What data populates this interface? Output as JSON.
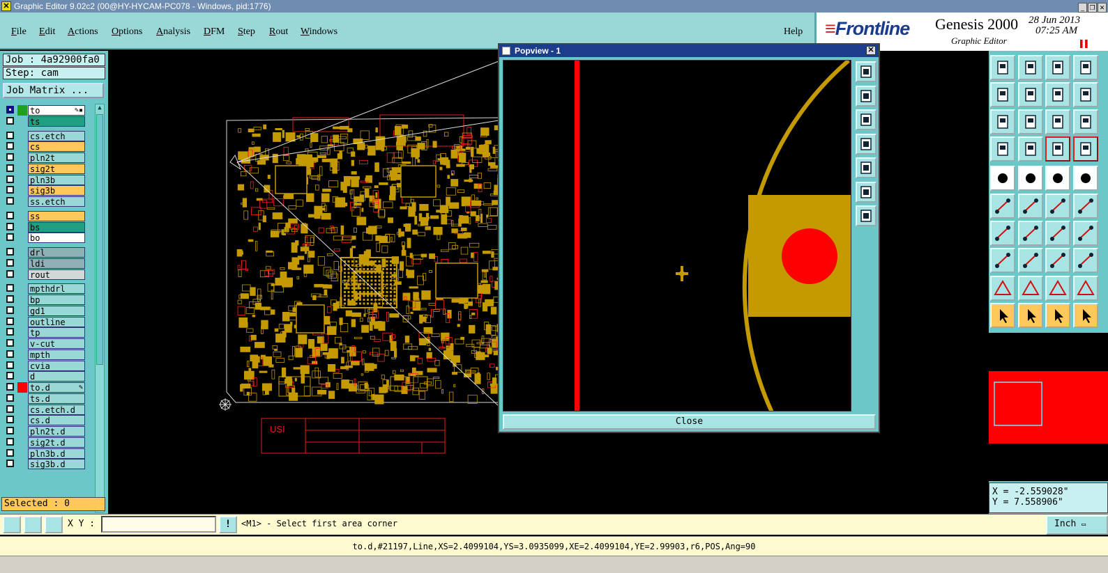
{
  "window": {
    "title": "Graphic Editor 9.02c2 (00@HY-HYCAM-PC078 - Windows, pid:1776)"
  },
  "menu": {
    "items": [
      {
        "label": "File",
        "u": "F",
        "rest": "ile"
      },
      {
        "label": "Edit",
        "u": "E",
        "rest": "dit"
      },
      {
        "label": "Actions",
        "u": "A",
        "rest": "ctions"
      },
      {
        "label": "Options",
        "u": "O",
        "rest": "ptions"
      },
      {
        "label": "Analysis",
        "u": "A",
        "rest": "nalysis"
      },
      {
        "label": "DFM",
        "u": "D",
        "rest": "FM"
      },
      {
        "label": "Step",
        "u": "S",
        "rest": "tep"
      },
      {
        "label": "Rout",
        "u": "R",
        "rest": "out"
      },
      {
        "label": "Windows",
        "u": "W",
        "rest": "indows"
      }
    ],
    "help": "Help"
  },
  "brand": {
    "logo": "Frontline",
    "product": "Genesis 2000",
    "subtitle": "Graphic Editor",
    "date": "28 Jun 2013",
    "time": "07:25 AM"
  },
  "job": {
    "label": "Job : 4a92900fa0",
    "step": "Step: cam",
    "matrix_button": "Job Matrix ..."
  },
  "layers": [
    {
      "name": "to",
      "color": "#ffffff",
      "swatch": "#20a020",
      "selected": true,
      "mark": "✎▪"
    },
    {
      "name": "ts",
      "color": "#20a080",
      "swatch": ""
    },
    {
      "name": "cs.etch",
      "color": "#9ad8d8",
      "swatch": ""
    },
    {
      "name": "cs",
      "color": "#ffc85a",
      "swatch": ""
    },
    {
      "name": "pln2t",
      "color": "#9ad8d8",
      "swatch": ""
    },
    {
      "name": "sig2t",
      "color": "#ffc85a",
      "swatch": ""
    },
    {
      "name": "pln3b",
      "color": "#9ad8d8",
      "swatch": ""
    },
    {
      "name": "sig3b",
      "color": "#ffc85a",
      "swatch": ""
    },
    {
      "name": "ss.etch",
      "color": "#9ad8d8",
      "swatch": ""
    },
    {
      "name": "ss",
      "color": "#ffc85a",
      "swatch": ""
    },
    {
      "name": "bs",
      "color": "#20a080",
      "swatch": ""
    },
    {
      "name": "bo",
      "color": "#ffffff",
      "swatch": ""
    },
    {
      "name": "drl",
      "color": "#90b0b8",
      "swatch": ""
    },
    {
      "name": "ldi",
      "color": "#90b0b8",
      "swatch": ""
    },
    {
      "name": "rout",
      "color": "#d0d8d8",
      "swatch": ""
    },
    {
      "name": "mpthdrl",
      "color": "#9ad8d8",
      "swatch": ""
    },
    {
      "name": "bp",
      "color": "#9ad8d8",
      "swatch": ""
    },
    {
      "name": "gd1",
      "color": "#9ad8d8",
      "swatch": ""
    },
    {
      "name": "outline",
      "color": "#9ad8d8",
      "swatch": ""
    },
    {
      "name": "tp",
      "color": "#9ad8d8",
      "swatch": ""
    },
    {
      "name": "v-cut",
      "color": "#9ad8d8",
      "swatch": ""
    },
    {
      "name": "mpth",
      "color": "#9ad8d8",
      "swatch": ""
    },
    {
      "name": "cvia",
      "color": "#9ad8d8",
      "swatch": ""
    },
    {
      "name": "d",
      "color": "#9ad8d8",
      "swatch": ""
    },
    {
      "name": "to.d",
      "color": "#9ad8d8",
      "swatch": "#ff0000",
      "mark": "✎"
    },
    {
      "name": "ts.d",
      "color": "#9ad8d8",
      "swatch": ""
    },
    {
      "name": "cs.etch.d",
      "color": "#9ad8d8",
      "swatch": ""
    },
    {
      "name": "cs.d",
      "color": "#9ad8d8",
      "swatch": ""
    },
    {
      "name": "pln2t.d",
      "color": "#9ad8d8",
      "swatch": ""
    },
    {
      "name": "sig2t.d",
      "color": "#9ad8d8",
      "swatch": ""
    },
    {
      "name": "pln3b.d",
      "color": "#9ad8d8",
      "swatch": ""
    },
    {
      "name": "sig3b.d",
      "color": "#9ad8d8",
      "swatch": ""
    }
  ],
  "selected": "Selected : 0",
  "popup": {
    "title": "Popview - 1",
    "close": "Close"
  },
  "coords": {
    "x": "X = -2.559028\"",
    "y": "Y = 7.558906\""
  },
  "cmd": {
    "xy_label": "X Y :",
    "xy_value": "",
    "prompt": "<M1> - Select first area corner",
    "units": "Inch"
  },
  "status": "to.d,#21197,Line,XS=2.4099104,YS=3.0935099,XE=2.4099104,YE=2.99903,r6,POS,Ang=90",
  "colors": {
    "panel": "#6cc8c8",
    "accent_red": "#ff0000",
    "gold": "#c49a00",
    "title_blue": "#1c3c8c"
  }
}
